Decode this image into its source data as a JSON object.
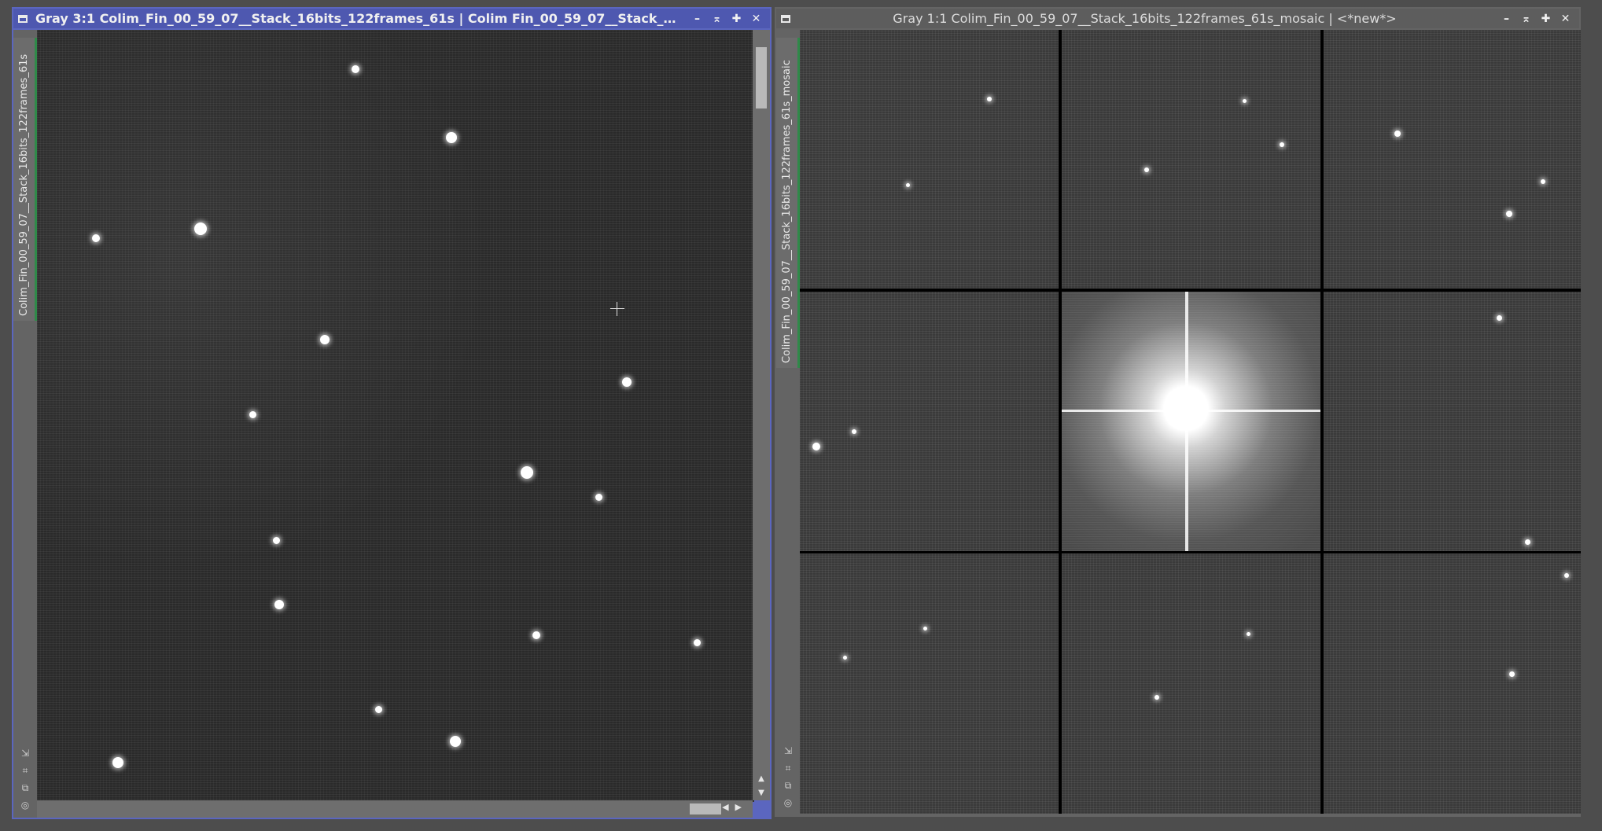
{
  "left_window": {
    "title": "Gray 3:1 Colim_Fin_00_59_07__Stack_16bits_122frames_61s | Colim Fin_00_59_07__Stack_16bits_...",
    "tab_label": "Colim_Fin_00_59_07__Stack_16bits_122frames_61s",
    "buttons": {
      "minimize": "–",
      "shade": "⌅",
      "maximize": "✚",
      "close": "✕"
    }
  },
  "right_window": {
    "title": "Gray 1:1 Colim_Fin_00_59_07__Stack_16bits_122frames_61s_mosaic | <*new*>",
    "tab_label": "Colim_Fin_00_59_07__Stack_16bits_122frames_61s_mosaic",
    "buttons": {
      "minimize": "–",
      "shade": "⌅",
      "maximize": "✚",
      "close": "✕"
    }
  },
  "icons": {
    "sidebar_tools": [
      "resize-icon",
      "crop-icon",
      "clone-icon",
      "target-icon"
    ],
    "cursor": "crosshair-icon"
  },
  "colors": {
    "active_title": "#4e58b0",
    "inactive_title": "#5d5d5d",
    "tab_accent": "#2f8a49"
  }
}
